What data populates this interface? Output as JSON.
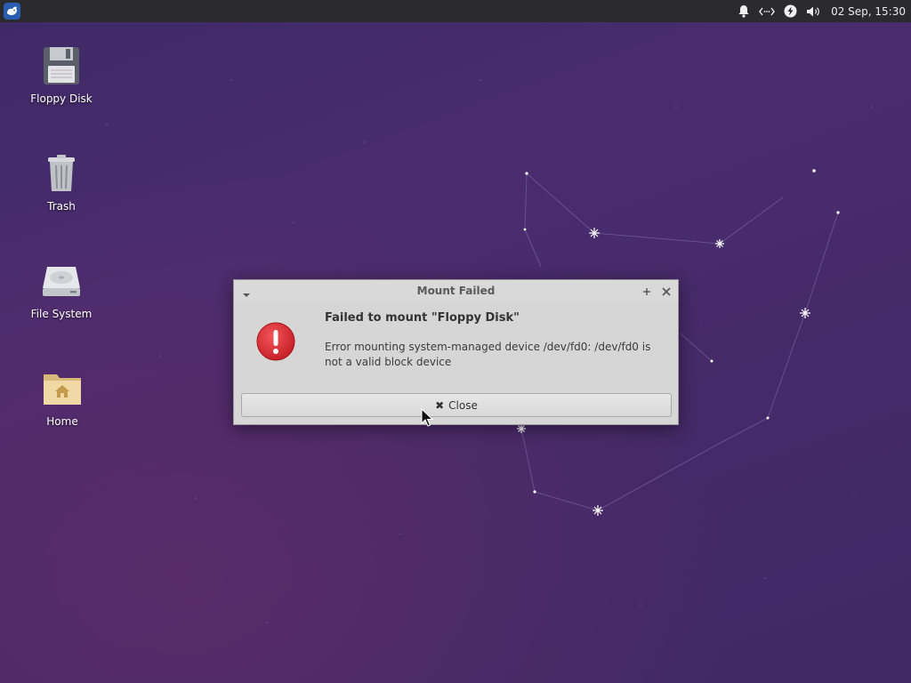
{
  "panel": {
    "menu_icon": "whisker-menu-icon",
    "tray_icons": [
      "bell-icon",
      "network-icon",
      "power-icon",
      "volume-icon"
    ],
    "clock": "02 Sep, 15:30"
  },
  "desktop": {
    "icons": [
      {
        "label": "Floppy Disk",
        "icon": "floppy-disk-icon"
      },
      {
        "label": "Trash",
        "icon": "trash-icon"
      },
      {
        "label": "File System",
        "icon": "hard-drive-icon"
      },
      {
        "label": "Home",
        "icon": "home-folder-icon"
      }
    ]
  },
  "dialog": {
    "title": "Mount Failed",
    "heading": "Failed to mount \"Floppy Disk\"",
    "message": "Error mounting system-managed device /dev/fd0: /dev/fd0 is not a valid block device",
    "close_label": "Close",
    "icon": "error-icon"
  },
  "colors": {
    "background": "#452a68",
    "panel": "#2b2b2e",
    "dialog": "#d6d6d6",
    "error": "#d8262c"
  }
}
